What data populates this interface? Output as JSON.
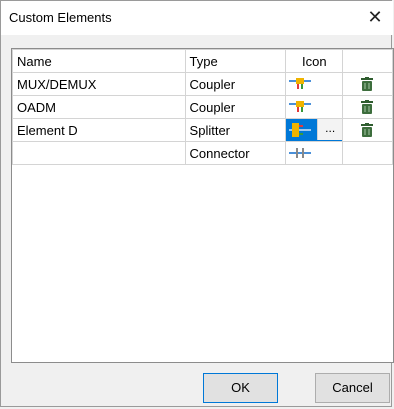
{
  "window": {
    "title": "Custom Elements"
  },
  "table": {
    "headers": {
      "name": "Name",
      "type": "Type",
      "icon": "Icon"
    },
    "rows": [
      {
        "name": "MUX/DEMUX",
        "type": "Coupler",
        "icon": "coupler-icon",
        "deletable": true
      },
      {
        "name": "OADM",
        "type": "Coupler",
        "icon": "coupler-icon",
        "deletable": true
      },
      {
        "name": "Element D",
        "type": "Splitter",
        "icon": "splitter-icon",
        "deletable": true,
        "selected": true
      },
      {
        "name": "",
        "type": "Connector",
        "icon": "connector-icon",
        "deletable": false
      }
    ],
    "browse_label": "..."
  },
  "buttons": {
    "ok": "OK",
    "cancel": "Cancel"
  },
  "colors": {
    "selection": "#0078d7",
    "trash": "#2f5d2f"
  }
}
